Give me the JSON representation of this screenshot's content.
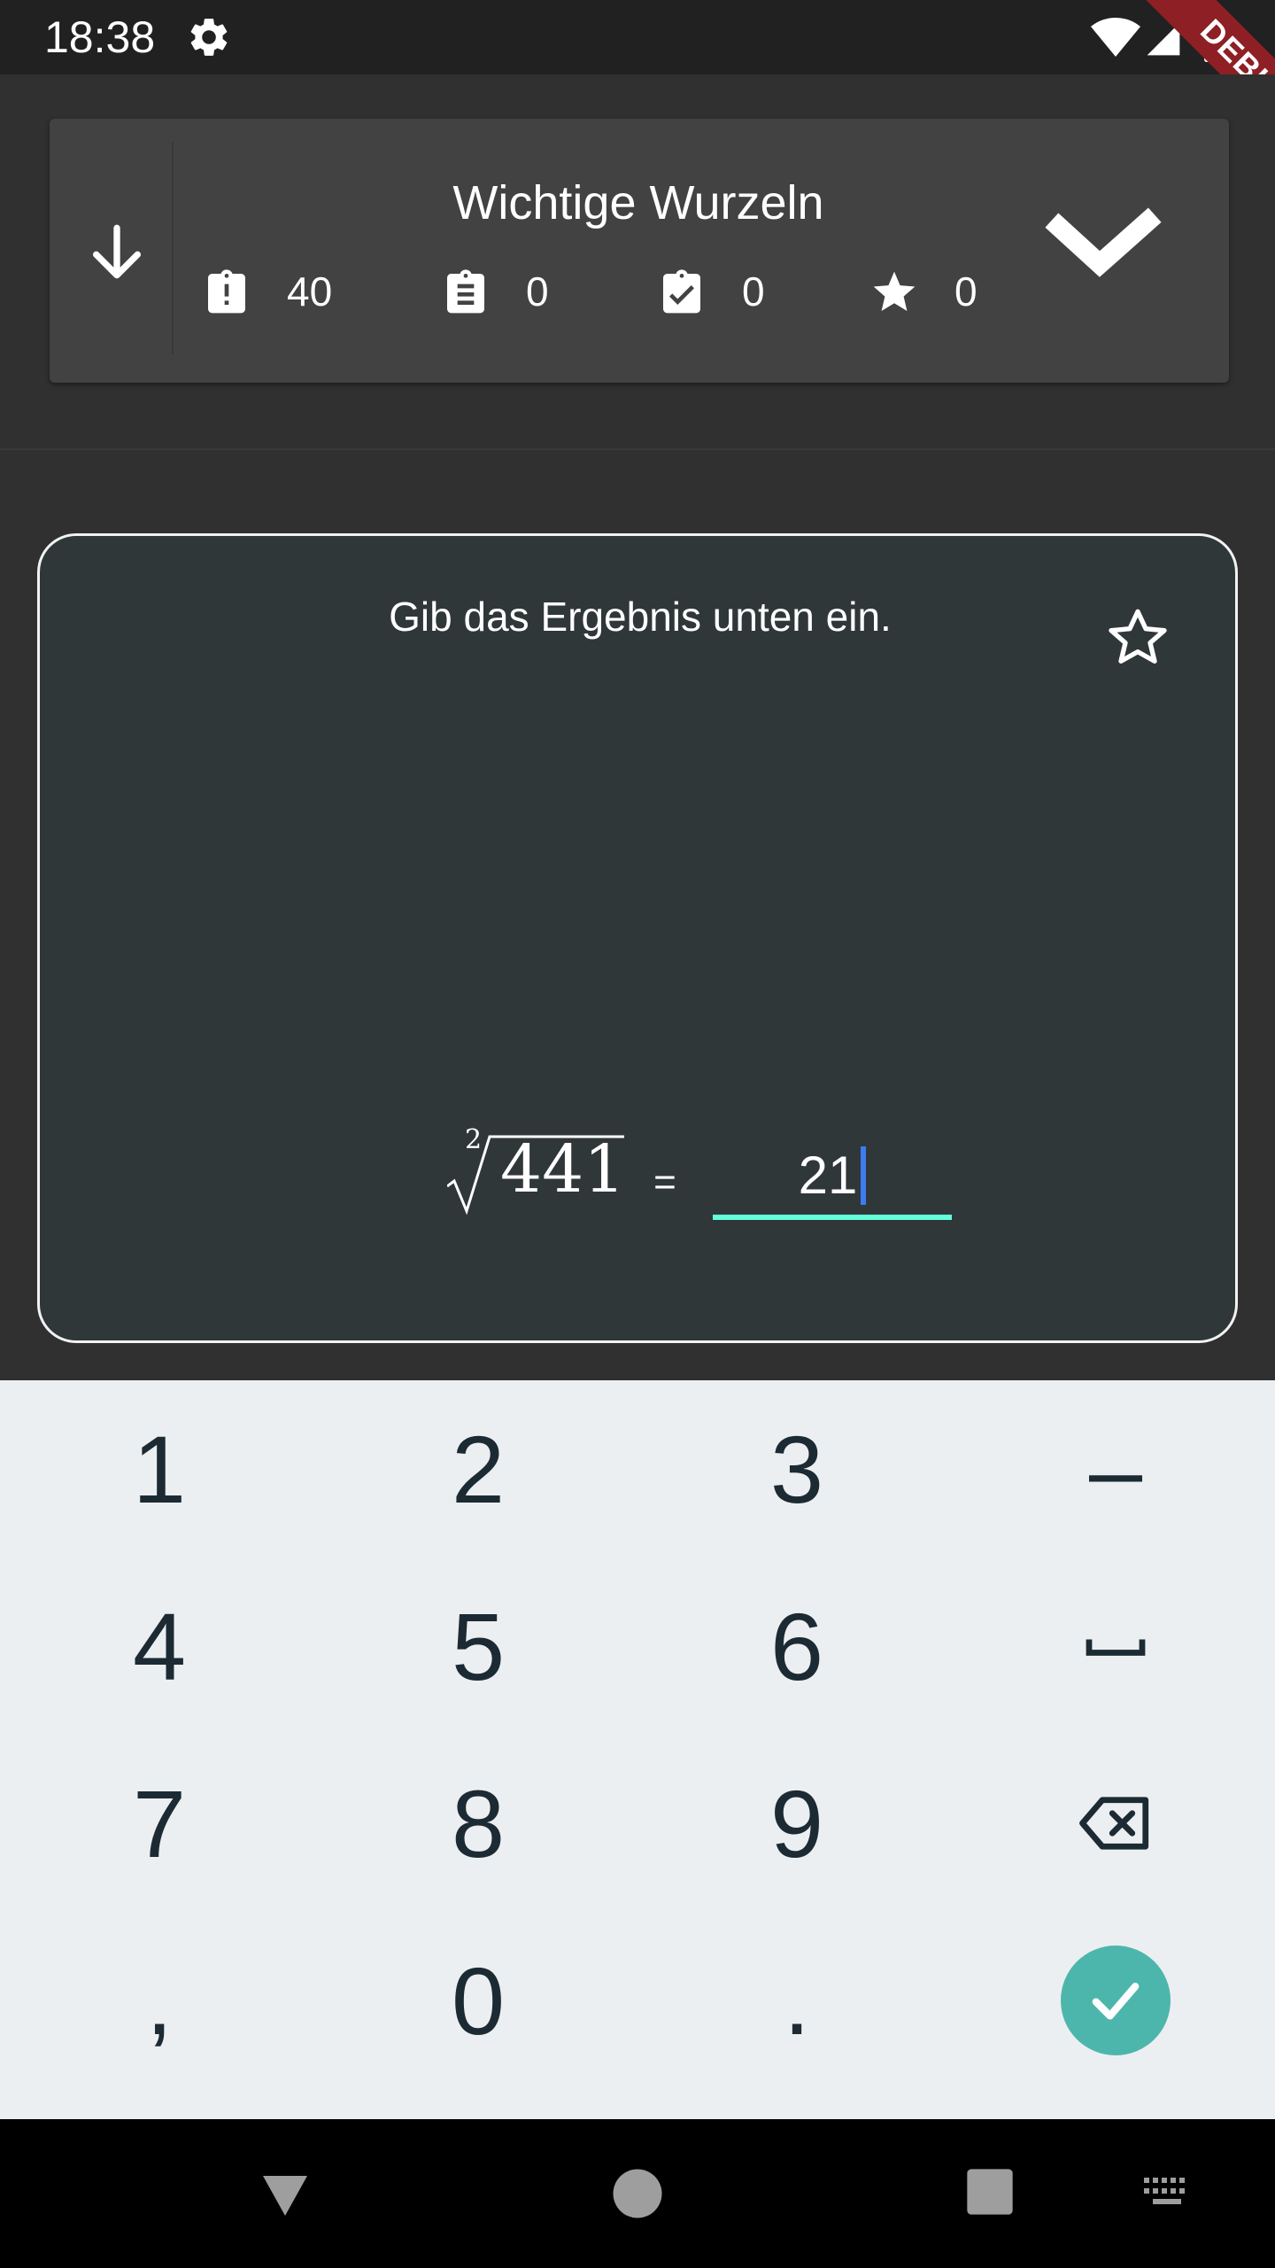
{
  "status_bar": {
    "time": "18:38",
    "icons": [
      "gear-icon",
      "wifi-icon",
      "signal-icon",
      "battery-icon"
    ],
    "debug_label": "DEBUG"
  },
  "set_header": {
    "title": "Wichtige Wurzeln",
    "stats": [
      {
        "icon": "clipboard-alert-icon",
        "value": "40"
      },
      {
        "icon": "clipboard-text-icon",
        "value": "0"
      },
      {
        "icon": "clipboard-check-icon",
        "value": "0"
      },
      {
        "icon": "star-icon",
        "value": "0"
      }
    ],
    "left_icon": "arrow-down-icon",
    "right_icon": "check-icon"
  },
  "question": {
    "instruction": "Gib das Ergebnis unten ein.",
    "root_index": "2",
    "radicand": "441",
    "equals": "=",
    "answer_value": "21",
    "favorite_icon": "star-outline-icon"
  },
  "keypad": {
    "keys": [
      "1",
      "2",
      "3",
      "–",
      "4",
      "5",
      "6",
      "␣",
      "7",
      "8",
      "9",
      "⌫",
      ",",
      "0",
      ".",
      "✓"
    ]
  },
  "colors": {
    "background": "#303030",
    "card": "#424242",
    "question_card": "#303739",
    "accent_underline": "#64ffda",
    "caret": "#3d7cf0",
    "done_button": "#4db6ac",
    "keypad_bg": "#eceff1",
    "debug_banner": "#8e1f24"
  }
}
